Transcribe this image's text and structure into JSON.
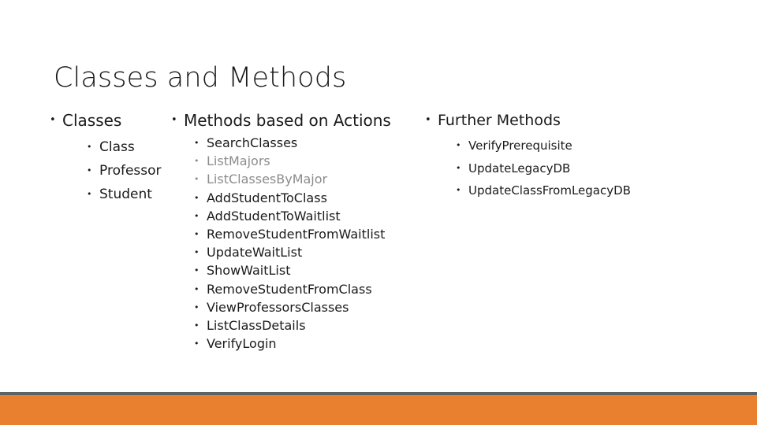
{
  "slide": {
    "title": "Classes and Methods",
    "background_color": "#ffffff",
    "text_color": "#1a1a1a",
    "muted_text_color": "#8c8c8c"
  },
  "columns": {
    "classes": {
      "heading": "Classes",
      "items": [
        {
          "label": "Class",
          "muted": false
        },
        {
          "label": "Professor",
          "muted": false
        },
        {
          "label": "Student",
          "muted": false
        }
      ]
    },
    "methods": {
      "heading": "Methods based on Actions",
      "items": [
        {
          "label": "SearchClasses",
          "muted": false
        },
        {
          "label": "ListMajors",
          "muted": true
        },
        {
          "label": "ListClassesByMajor",
          "muted": true
        },
        {
          "label": "AddStudentToClass",
          "muted": false
        },
        {
          "label": "AddStudentToWaitlist",
          "muted": false
        },
        {
          "label": "RemoveStudentFromWaitlist",
          "muted": false
        },
        {
          "label": "UpdateWaitList",
          "muted": false
        },
        {
          "label": "ShowWaitList",
          "muted": false
        },
        {
          "label": "RemoveStudentFromClass",
          "muted": false
        },
        {
          "label": "ViewProfessorsClasses",
          "muted": false
        },
        {
          "label": "ListClassDetails",
          "muted": false
        },
        {
          "label": "VerifyLogin",
          "muted": false
        }
      ]
    },
    "further": {
      "heading": "Further Methods",
      "items": [
        {
          "label": "VerifyPrerequisite",
          "muted": false
        },
        {
          "label": "UpdateLegacyDB",
          "muted": false
        },
        {
          "label": "UpdateClassFromLegacyDB",
          "muted": false
        }
      ]
    }
  },
  "footer": {
    "rule_color": "#5b6268",
    "band_color": "#e8802f"
  }
}
